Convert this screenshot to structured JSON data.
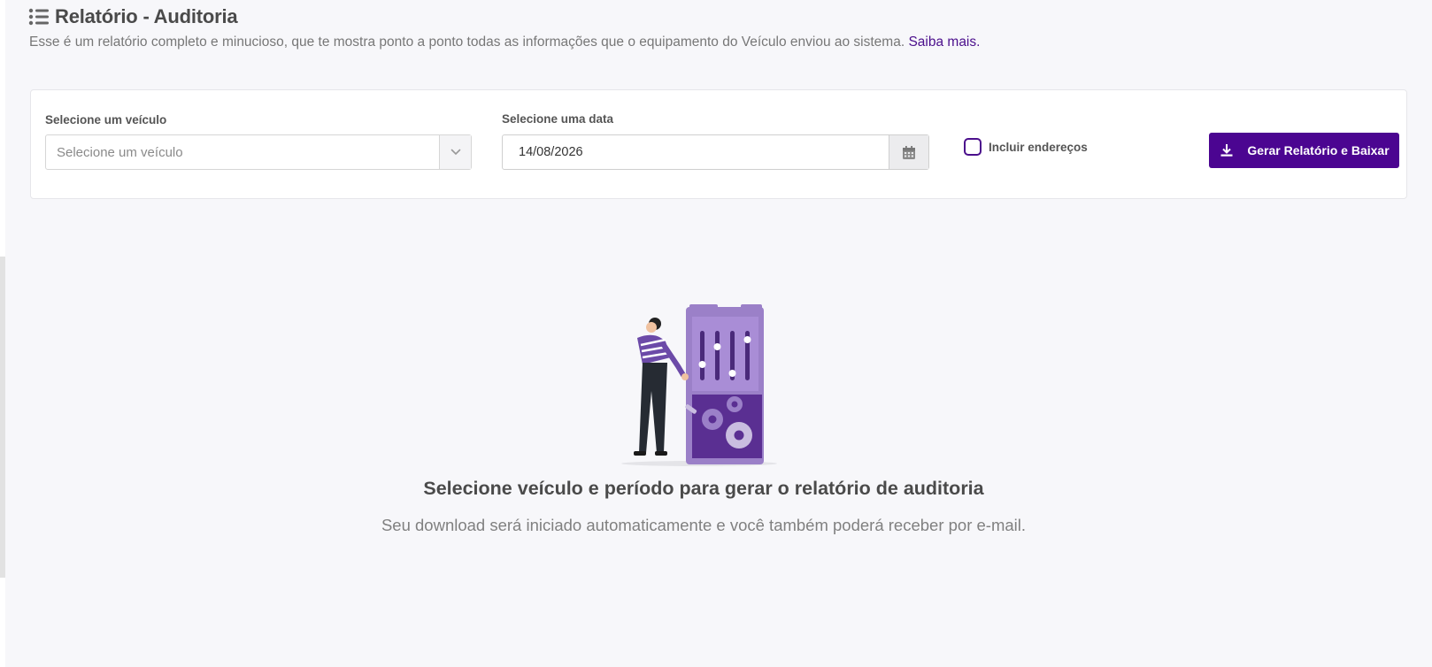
{
  "header": {
    "title": "Relatório - Auditoria",
    "subtitle": "Esse é um relatório completo e minucioso, que te mostra ponto a ponto todas as informações que o equipamento do Veículo enviou ao sistema.",
    "learn_more": "Saiba mais."
  },
  "filters": {
    "vehicle_label": "Selecione um veículo",
    "vehicle_placeholder": "Selecione um veículo",
    "date_label": "Selecione uma data",
    "date_value": "14/08/2026",
    "include_addresses_label": "Incluir endereços",
    "include_addresses_checked": false,
    "generate_button": "Gerar Relatório e Baixar"
  },
  "empty_state": {
    "title": "Selecione veículo e período para gerar o relatório de auditoria",
    "subtitle": "Seu download será iniciado automaticamente e você também poderá receber por e-mail."
  },
  "colors": {
    "brand": "#4b0591",
    "link": "#4b0f8c",
    "background": "#f7f7fa"
  },
  "icons": {
    "header": "list-icon",
    "select": "chevron-down-icon",
    "date": "calendar-icon",
    "button": "download-icon"
  }
}
